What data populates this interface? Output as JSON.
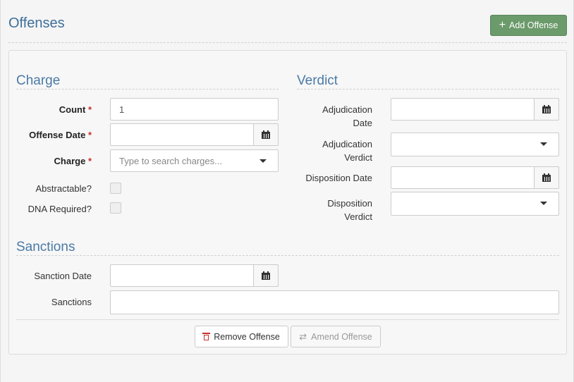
{
  "header": {
    "title": "Offenses",
    "add_button": "Add Offense"
  },
  "charge": {
    "title": "Charge",
    "count_label": "Count",
    "count_value": "1",
    "offense_date_label": "Offense Date",
    "offense_date_value": "",
    "charge_label": "Charge",
    "charge_placeholder": "Type to search charges...",
    "abstractable_label": "Abstractable?",
    "dna_label": "DNA Required?",
    "required_marker": "*"
  },
  "verdict": {
    "title": "Verdict",
    "adjudication_date_label_1": "Adjudication",
    "adjudication_date_label_2": "Date",
    "adjudication_verdict_label_1": "Adjudication",
    "adjudication_verdict_label_2": "Verdict",
    "disposition_date_label": "Disposition Date",
    "disposition_verdict_label_1": "Disposition",
    "disposition_verdict_label_2": "Verdict"
  },
  "sanctions": {
    "title": "Sanctions",
    "date_label": "Sanction Date",
    "sanctions_label": "Sanctions"
  },
  "footer": {
    "remove_button": "Remove Offense",
    "amend_button": "Amend Offense"
  },
  "icons": {
    "add": "plus-icon",
    "calendar": "calendar-icon",
    "dropdown": "caret-down-icon",
    "remove": "trash-icon",
    "amend": "exchange-icon"
  },
  "colors": {
    "title": "#3d6e99",
    "add_button": "#6b9a6b",
    "required": "#c9302c"
  }
}
